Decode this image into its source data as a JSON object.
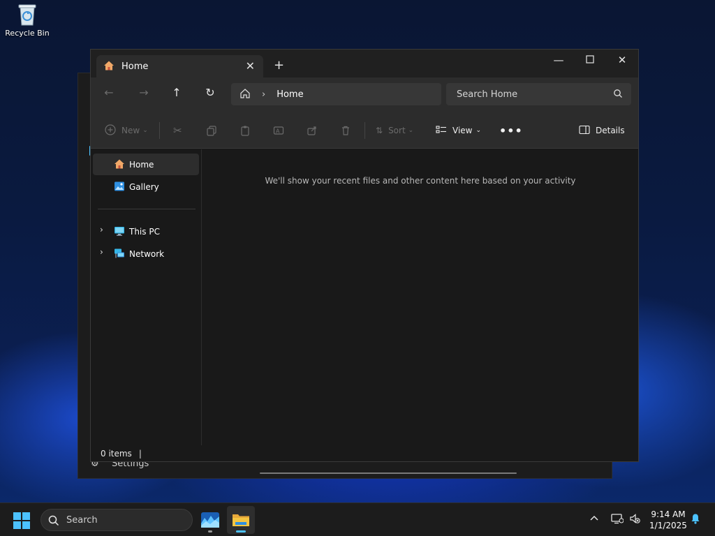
{
  "desktop": {
    "recycle_bin_label": "Recycle Bin"
  },
  "background_window": {
    "settings_label": "Settings"
  },
  "explorer": {
    "tab_title": "Home",
    "address": {
      "current": "Home"
    },
    "search_placeholder": "Search Home",
    "toolbar": {
      "new_label": "New",
      "sort_label": "Sort",
      "view_label": "View",
      "details_label": "Details"
    },
    "sidebar": {
      "items": [
        {
          "label": "Home",
          "icon": "home-icon",
          "selected": true
        },
        {
          "label": "Gallery",
          "icon": "gallery-icon"
        },
        {
          "label": "This PC",
          "icon": "this-pc-icon",
          "expandable": true
        },
        {
          "label": "Network",
          "icon": "network-icon",
          "expandable": true
        }
      ]
    },
    "empty_message": "We'll show your recent files and other content here based on your activity",
    "status": {
      "items_count": "0 items"
    }
  },
  "taskbar": {
    "search_label": "Search",
    "time": "9:14 AM",
    "date": "1/1/2025"
  },
  "colors": {
    "accent": "#4cc2ff",
    "folder": "#f4c542",
    "home_icon": "#f0a868"
  }
}
